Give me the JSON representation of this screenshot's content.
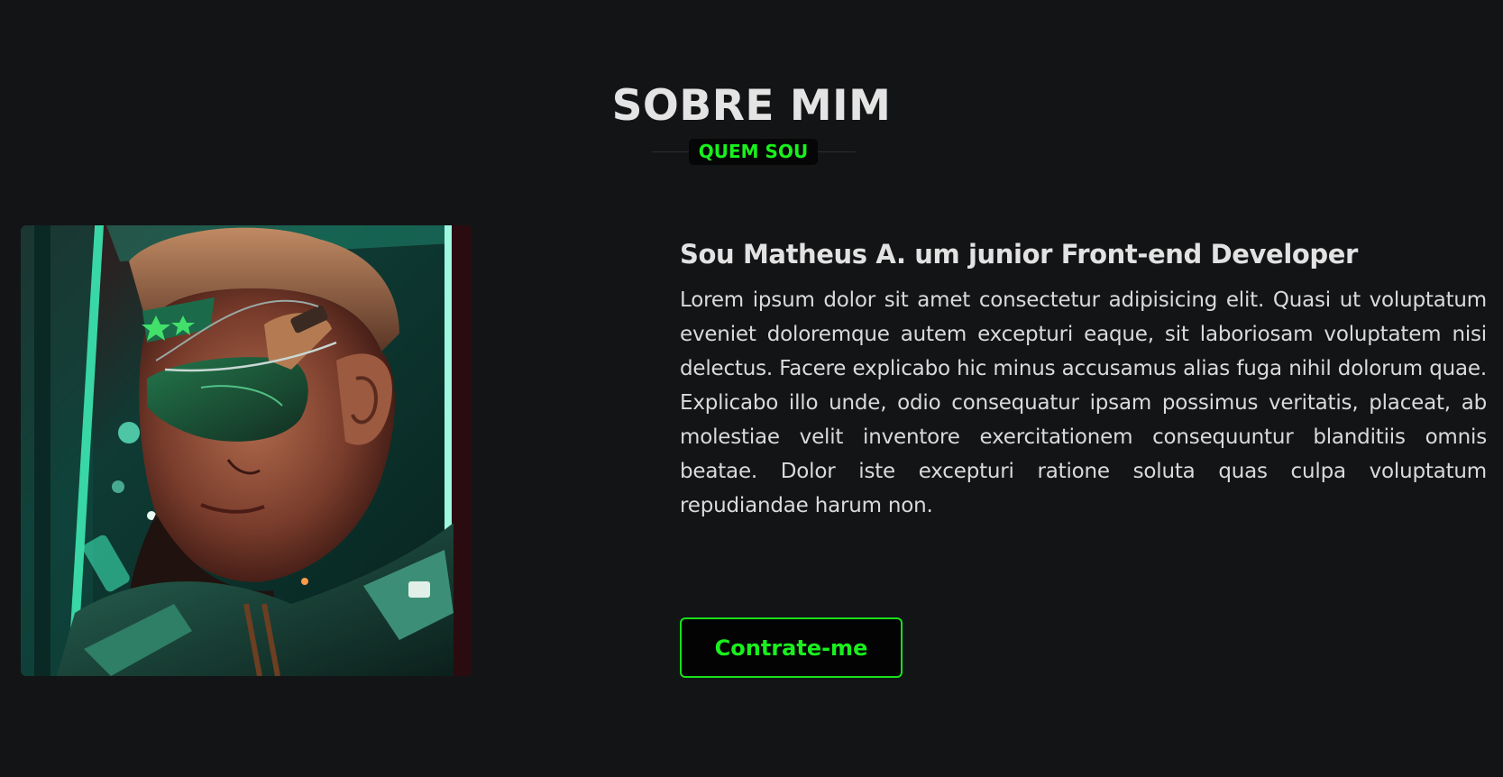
{
  "section": {
    "title": "SOBRE MIM",
    "subtitle": "QUEM SOU"
  },
  "about": {
    "headline": "Sou Matheus A. um junior Front-end Developer",
    "bio": "Lorem ipsum dolor sit amet consectetur adipisicing elit. Quasi ut voluptatum eveniet doloremque autem excepturi eaque, sit laboriosam voluptatem nisi delectus. Facere explicabo hic minus accusamus alias fuga nihil dolorum quae. Explicabo illo unde, odio consequatur ipsam possimus veritatis, placeat, ab molestiae velit inventore exercitationem consequuntur blanditiis omnis beatae. Dolor iste excepturi ratione soluta quas culpa voluptatum repudiandae harum non.",
    "cta_label": "Contrate-me"
  },
  "image": {
    "subject": "cyberpunk-portrait"
  },
  "colors": {
    "background": "#131416",
    "accent": "#19f01d",
    "text": "#dcdcdc"
  }
}
